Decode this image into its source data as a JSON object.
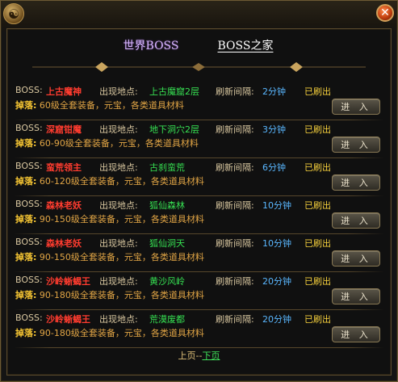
{
  "header": {
    "tab_world": "世界BOSS",
    "tab_home": "BOSS之家",
    "close_glyph": "✕"
  },
  "labels": {
    "boss": "BOSS:",
    "location": "出现地点:",
    "interval": "刷新间隔:",
    "drop": "掉落:",
    "enter": "进 入"
  },
  "entries": [
    {
      "name": "上古魔神",
      "location": "上古魔窟2层",
      "interval": "2分钟",
      "status": "已刷出",
      "drops": "60级全套装备，元宝，各类道具材料"
    },
    {
      "name": "深窟钳魔",
      "location": "地下洞穴2层",
      "interval": "3分钟",
      "status": "已刷出",
      "drops": "60-90级全套装备，元宝，各类道具材料"
    },
    {
      "name": "蛮荒领主",
      "location": "古刹蛮荒",
      "interval": "6分钟",
      "status": "已刷出",
      "drops": "60-120级全套装备，元宝，各类道具材料"
    },
    {
      "name": "森林老妖",
      "location": "狐仙森林",
      "interval": "10分钟",
      "status": "已刷出",
      "drops": "90-150级全套装备，元宝，各类道具材料"
    },
    {
      "name": "森林老妖",
      "location": "狐仙洞天",
      "interval": "10分钟",
      "status": "已刷出",
      "drops": "90-150级全套装备，元宝，各类道具材料"
    },
    {
      "name": "沙岭蜥蝎王",
      "location": "黄沙风岭",
      "interval": "20分钟",
      "status": "已刷出",
      "drops": "90-180级全套装备，元宝，各类道具材料"
    },
    {
      "name": "沙岭蜥蝎王",
      "location": "荒漠废都",
      "interval": "20分钟",
      "status": "已刷出",
      "drops": "90-180级全套装备，元宝，各类道具材料"
    }
  ],
  "pager": {
    "prev": "上页",
    "separator": "--",
    "next": "下页"
  },
  "colors": {
    "boss_name": "#ff3c2f",
    "location": "#36e052",
    "interval": "#5ab7ff",
    "status": "#f6d03c",
    "drop_label": "#f5c533"
  }
}
